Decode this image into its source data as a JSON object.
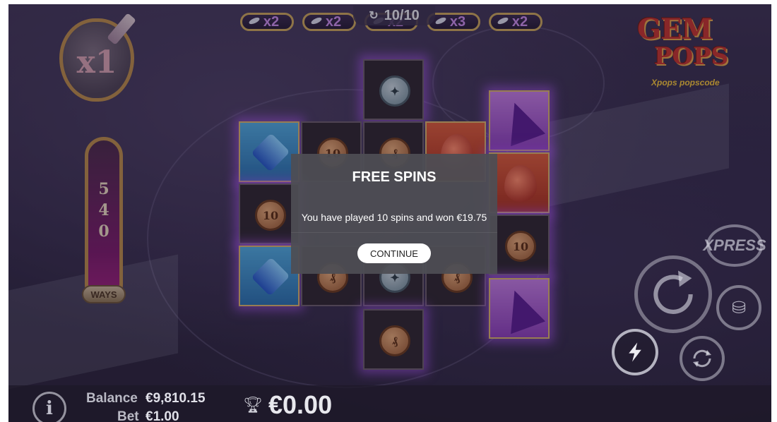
{
  "game": {
    "logo": {
      "line1": "GEM",
      "line2": "POPS",
      "tagline": "Xpops popscode"
    },
    "multiplier": "x1",
    "spin_counter": {
      "icon": "refresh-icon",
      "text": "10/10"
    },
    "multipliers_top": [
      "x2",
      "x2",
      "x2",
      "x3",
      "x2"
    ],
    "ways": {
      "digits": [
        "5",
        "4",
        "0"
      ],
      "label": "WAYS"
    }
  },
  "dialog": {
    "title": "FREE SPINS",
    "message": "You have played 10 spins and won €19.75",
    "button": "CONTINUE"
  },
  "controls": {
    "xpress_label": "XPRESS",
    "spin_icon": "refresh-icon",
    "coins_icon": "coin-stack-icon",
    "turbo_icon": "lightning-icon",
    "auto_icon": "autoplay-icon"
  },
  "bottom": {
    "info_icon": "info-icon",
    "balance_label": "Balance",
    "balance_value": "€9,810.15",
    "bet_label": "Bet",
    "bet_value": "€1.00",
    "win_icon": "trophy-icon",
    "win_value": "€0.00"
  },
  "colors": {
    "accent_gold": "#c9a45a",
    "glow_purple": "#b45aff",
    "dialog_bg": "#4e4e54"
  },
  "reels": [
    {
      "symbol": "silver-coin"
    },
    {
      "symbol": "purple-spike"
    },
    {
      "symbol": "blue-crystal"
    },
    {
      "symbol": "bronze-coin",
      "text": "10"
    },
    {
      "symbol": "bronze-coin"
    },
    {
      "symbol": "red-drop"
    },
    {
      "symbol": "red-drop"
    },
    {
      "symbol": "bronze-coin",
      "text": "10"
    },
    {
      "symbol": "bronze-coin",
      "text": "10"
    },
    {
      "symbol": "blue-crystal"
    },
    {
      "symbol": "bronze-coin"
    },
    {
      "symbol": "silver-coin"
    },
    {
      "symbol": "bronze-coin"
    },
    {
      "symbol": "purple-spike"
    },
    {
      "symbol": "bronze-coin"
    }
  ]
}
